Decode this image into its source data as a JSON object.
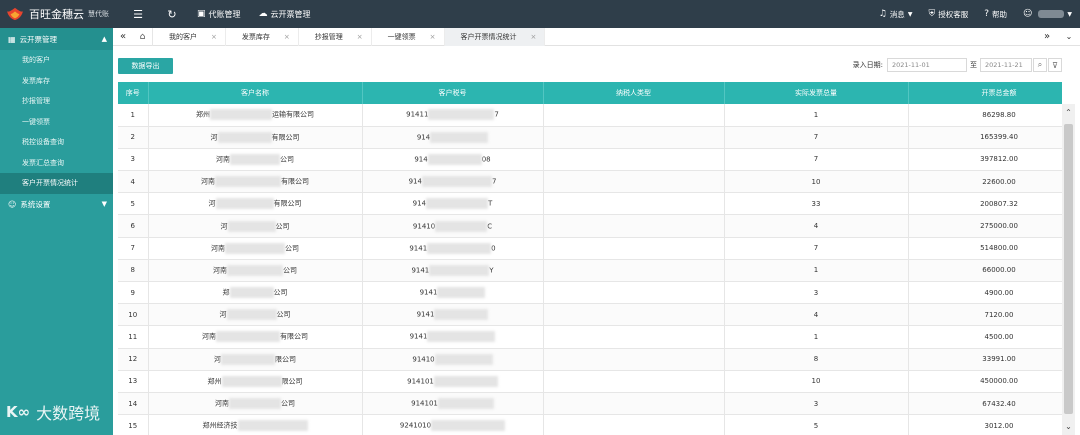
{
  "brand": {
    "name": "百旺金穗云",
    "subtitle": "慧代账"
  },
  "topnav": [
    {
      "icon": "building-icon",
      "label": "代账管理"
    },
    {
      "icon": "cloud-icon",
      "label": "云开票管理"
    }
  ],
  "topright": {
    "messages": "消息",
    "auth": "授权客服",
    "help": "帮助"
  },
  "sidebar": {
    "group1": "云开票管理",
    "items": [
      "我的客户",
      "发票库存",
      "抄报管理",
      "一键领票",
      "税控设备查询",
      "发票汇总查询",
      "客户开票情况统计"
    ],
    "active_index": 6,
    "group2": "系统设置"
  },
  "tabs": [
    {
      "label": "我的客户"
    },
    {
      "label": "发票库存"
    },
    {
      "label": "抄报管理"
    },
    {
      "label": "一键领票"
    },
    {
      "label": "客户开票情况统计"
    }
  ],
  "toolbar": {
    "export_label": "数据导出",
    "date_label": "录入日期:",
    "date_from": "2021-11-01",
    "to_label": "至",
    "date_to": "2021-11-21"
  },
  "table": {
    "headers": [
      "序号",
      "客户名称",
      "客户税号",
      "纳税人类型",
      "实际发票总量",
      "开票总金额"
    ],
    "rows": [
      {
        "idx": "1",
        "name_pre": "郑州",
        "name_suf": "运输有限公司",
        "tax_pre": "91411",
        "tax_suf": "7",
        "type": "",
        "count": "1",
        "amount": "86298.80"
      },
      {
        "idx": "2",
        "name_pre": "河",
        "name_suf": "有限公司",
        "tax_pre": "914",
        "tax_suf": "",
        "type": "",
        "count": "7",
        "amount": "165399.40"
      },
      {
        "idx": "3",
        "name_pre": "河南",
        "name_suf": "公司",
        "tax_pre": "914",
        "tax_suf": "08",
        "type": "",
        "count": "7",
        "amount": "397812.00"
      },
      {
        "idx": "4",
        "name_pre": "河南",
        "name_suf": "有限公司",
        "tax_pre": "914",
        "tax_suf": "7",
        "type": "",
        "count": "10",
        "amount": "22600.00"
      },
      {
        "idx": "5",
        "name_pre": "河",
        "name_suf": "有限公司",
        "tax_pre": "914",
        "tax_suf": "T",
        "type": "",
        "count": "33",
        "amount": "200807.32"
      },
      {
        "idx": "6",
        "name_pre": "河",
        "name_suf": "公司",
        "tax_pre": "91410",
        "tax_suf": "C",
        "type": "",
        "count": "4",
        "amount": "275000.00"
      },
      {
        "idx": "7",
        "name_pre": "河南",
        "name_suf": "公司",
        "tax_pre": "9141",
        "tax_suf": "0",
        "type": "",
        "count": "7",
        "amount": "514800.00"
      },
      {
        "idx": "8",
        "name_pre": "河南",
        "name_suf": "公司",
        "tax_pre": "9141",
        "tax_suf": "Y",
        "type": "",
        "count": "1",
        "amount": "66000.00"
      },
      {
        "idx": "9",
        "name_pre": "郑",
        "name_suf": "公司",
        "tax_pre": "9141",
        "tax_suf": "",
        "type": "",
        "count": "3",
        "amount": "4900.00"
      },
      {
        "idx": "10",
        "name_pre": "河",
        "name_suf": "公司",
        "tax_pre": "9141",
        "tax_suf": "",
        "type": "",
        "count": "4",
        "amount": "7120.00"
      },
      {
        "idx": "11",
        "name_pre": "河南",
        "name_suf": "有限公司",
        "tax_pre": "9141",
        "tax_suf": "",
        "type": "",
        "count": "1",
        "amount": "4500.00"
      },
      {
        "idx": "12",
        "name_pre": "河",
        "name_suf": "限公司",
        "tax_pre": "91410",
        "tax_suf": "",
        "type": "",
        "count": "8",
        "amount": "33991.00"
      },
      {
        "idx": "13",
        "name_pre": "郑州",
        "name_suf": "限公司",
        "tax_pre": "914101",
        "tax_suf": "",
        "type": "",
        "count": "10",
        "amount": "450000.00"
      },
      {
        "idx": "14",
        "name_pre": "河南",
        "name_suf": "公司",
        "tax_pre": "914101",
        "tax_suf": "",
        "type": "",
        "count": "3",
        "amount": "67432.40"
      },
      {
        "idx": "15",
        "name_pre": "郑州经济技",
        "name_suf": "",
        "tax_pre": "9241010",
        "tax_suf": "",
        "type": "",
        "count": "5",
        "amount": "3012.00"
      }
    ]
  },
  "watermark": {
    "text": "大数跨境"
  },
  "colors": {
    "header_bg": "#2f3e4a",
    "sidebar_bg": "#2a9d9c",
    "table_header": "#2cb5b0",
    "accent": "#2aa6a4"
  }
}
